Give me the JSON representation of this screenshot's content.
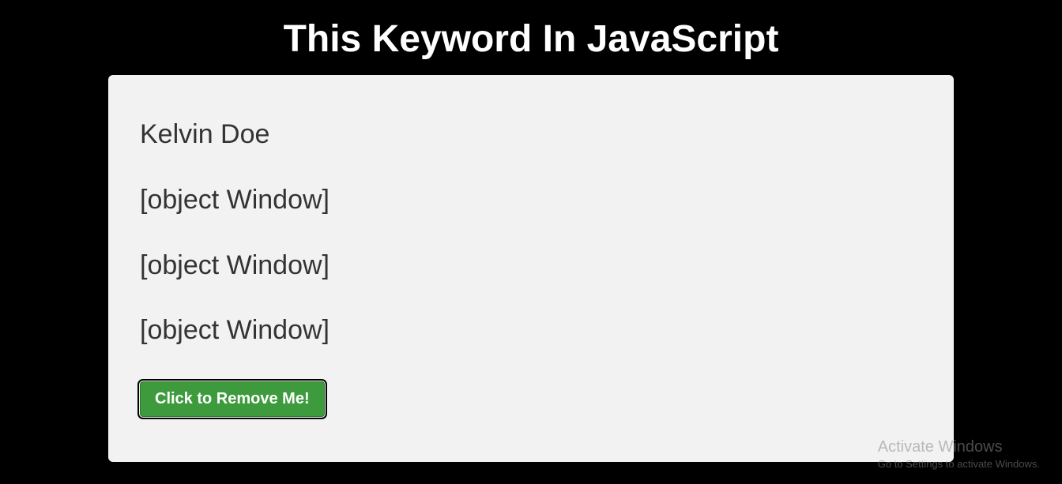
{
  "header": {
    "title": "This Keyword In JavaScript"
  },
  "content": {
    "lines": [
      "Kelvin Doe",
      "[object Window]",
      "[object Window]",
      "[object Window]"
    ],
    "button_label": "Click to Remove Me!"
  },
  "watermark": {
    "title": "Activate Windows",
    "subtitle": "Go to Settings to activate Windows."
  }
}
